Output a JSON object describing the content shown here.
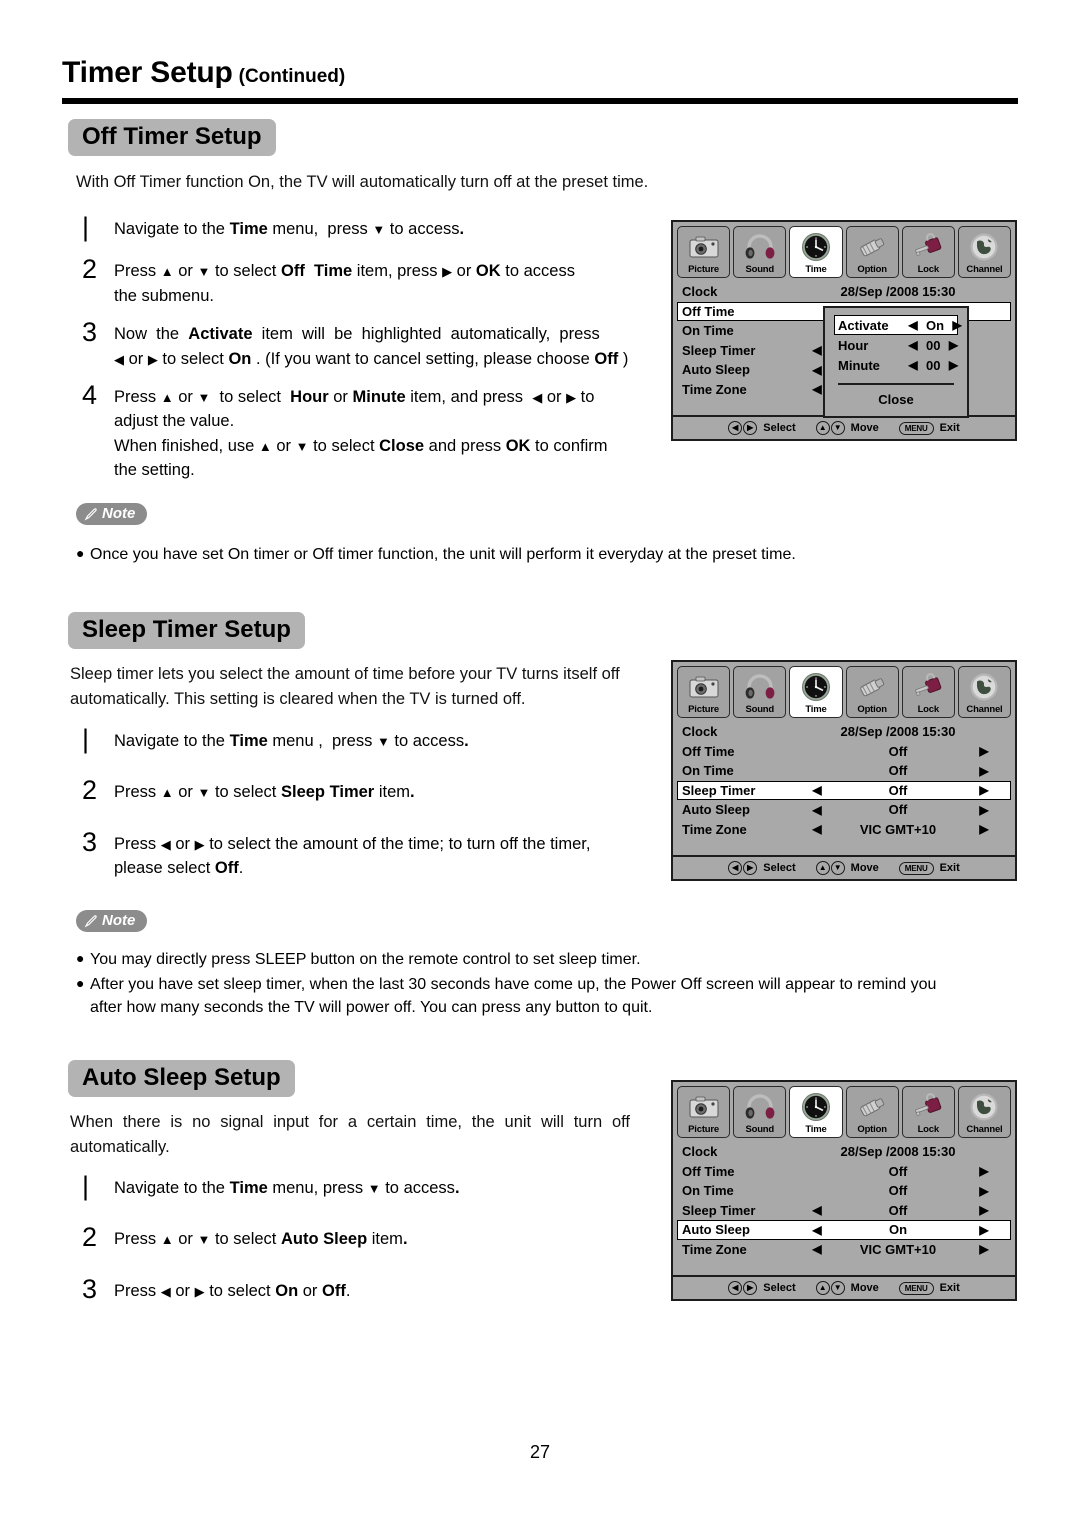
{
  "header": {
    "title": "Timer Setup",
    "subtitle": "(Continued)"
  },
  "page_number": "27",
  "sections": [
    {
      "badge": "Off Timer Setup",
      "intro": "With Off Timer function On, the TV will automatically turn off at the preset time.",
      "steps": [
        {
          "num": "1",
          "text": "Navigate to the Time menu,  press ▼ to access."
        },
        {
          "num": "2",
          "text": "Press ▲ or ▼ to select Off Time item, press ▶ or OK to access the submenu."
        },
        {
          "num": "3",
          "text": "Now the Activate item will be highlighted automatically, press ◀ or ▶ to select On . (If you want to cancel setting, please choose Off )"
        },
        {
          "num": "4",
          "text": "Press ▲ or ▼ to select Hour or Minute item, and press ◀ or ▶ to adjust the value. When finished, use ▲ or ▼ to select Close and press OK to confirm the setting."
        }
      ],
      "note": {
        "label": "Note",
        "items": [
          "Once you have set On timer or Off timer function, the unit will perform it everyday at the preset time."
        ]
      }
    },
    {
      "badge": "Sleep Timer Setup",
      "intro": "Sleep timer lets you select the amount of time before your TV turns itself off automatically. This setting is cleared when the TV is turned off.",
      "steps": [
        {
          "num": "1",
          "text": "Navigate to the Time menu ,  press ▼ to access."
        },
        {
          "num": "2",
          "text": "Press ▲ or ▼ to select Sleep Timer item."
        },
        {
          "num": "3",
          "text": "Press ◀ or ▶ to select the amount of the time; to turn off the timer, please select Off."
        }
      ],
      "note": {
        "label": "Note",
        "items": [
          "You may directly press SLEEP button on the remote control to set sleep timer.",
          "After you have set sleep timer, when the last 30 seconds have come up, the Power Off screen will appear to remind you after how many seconds the TV will power off. You can press any button to quit."
        ]
      }
    },
    {
      "badge": "Auto Sleep Setup",
      "intro": "When there is no signal input for a certain time, the unit will turn off automatically.",
      "steps": [
        {
          "num": "1",
          "text": "Navigate to the Time menu, press ▼ to access."
        },
        {
          "num": "2",
          "text": "Press ▲ or ▼ to select Auto Sleep item."
        },
        {
          "num": "3",
          "text": "Press ◀ or ▶ to select On or Off."
        }
      ],
      "note": null
    }
  ],
  "osd_tabs": [
    {
      "label": "Picture",
      "icon": "camera-icon",
      "selected": false
    },
    {
      "label": "Sound",
      "icon": "headphones-icon",
      "selected": false
    },
    {
      "label": "Time",
      "icon": "clock-icon",
      "selected": true
    },
    {
      "label": "Option",
      "icon": "connector-icon",
      "selected": false
    },
    {
      "label": "Lock",
      "icon": "padlock-icon",
      "selected": false
    },
    {
      "label": "Channel",
      "icon": "globe-icon",
      "selected": false
    }
  ],
  "osd_status": {
    "select_label": "Select",
    "move_label": "Move",
    "exit_label": "Exit",
    "menu_key": "MENU",
    "left_arrow": "◀",
    "right_arrow": "▶",
    "up_arrow": "▲",
    "down_arrow": "▼"
  },
  "osd_menus": [
    {
      "id": "off-time-menu",
      "rows": [
        {
          "label": "Clock",
          "left": "",
          "value": "28/Sep /2008 15:30",
          "right": "",
          "highlight": false
        },
        {
          "label": "Off Time",
          "left": "",
          "value": "",
          "right": "",
          "highlight": true
        },
        {
          "label": "On Time",
          "left": "",
          "value": "",
          "right": "",
          "highlight": false
        },
        {
          "label": "Sleep Timer",
          "left": "◀",
          "value": "",
          "right": "",
          "highlight": false
        },
        {
          "label": "Auto Sleep",
          "left": "◀",
          "value": "",
          "right": "",
          "highlight": false
        },
        {
          "label": "Time Zone",
          "left": "◀",
          "value": "",
          "right": "",
          "highlight": false
        }
      ],
      "popup": {
        "rows": [
          {
            "label": "Activate",
            "left": "◀",
            "value": "On",
            "right": "▶",
            "highlight": true
          },
          {
            "label": "Hour",
            "left": "◀",
            "value": "00",
            "right": "▶",
            "highlight": false
          },
          {
            "label": "Minute",
            "left": "◀",
            "value": "00",
            "right": "▶",
            "highlight": false
          }
        ],
        "close_label": "Close"
      }
    },
    {
      "id": "sleep-timer-menu",
      "rows": [
        {
          "label": "Clock",
          "left": "",
          "value": "28/Sep /2008 15:30",
          "right": "",
          "highlight": false
        },
        {
          "label": "Off Time",
          "left": "",
          "value": "Off",
          "right": "▶",
          "highlight": false
        },
        {
          "label": "On Time",
          "left": "",
          "value": "Off",
          "right": "▶",
          "highlight": false
        },
        {
          "label": "Sleep Timer",
          "left": "◀",
          "value": "Off",
          "right": "▶",
          "highlight": true
        },
        {
          "label": "Auto Sleep",
          "left": "◀",
          "value": "Off",
          "right": "▶",
          "highlight": false
        },
        {
          "label": "Time Zone",
          "left": "◀",
          "value": "VIC GMT+10",
          "right": "▶",
          "highlight": false
        }
      ],
      "popup": null
    },
    {
      "id": "auto-sleep-menu",
      "rows": [
        {
          "label": "Clock",
          "left": "",
          "value": "28/Sep /2008 15:30",
          "right": "",
          "highlight": false
        },
        {
          "label": "Off Time",
          "left": "",
          "value": "Off",
          "right": "▶",
          "highlight": false
        },
        {
          "label": "On Time",
          "left": "",
          "value": "Off",
          "right": "▶",
          "highlight": false
        },
        {
          "label": "Sleep Timer",
          "left": "◀",
          "value": "Off",
          "right": "▶",
          "highlight": false
        },
        {
          "label": "Auto Sleep",
          "left": "◀",
          "value": "On",
          "right": "▶",
          "highlight": true
        },
        {
          "label": "Time Zone",
          "left": "◀",
          "value": "VIC GMT+10",
          "right": "▶",
          "highlight": false
        }
      ],
      "popup": null
    }
  ]
}
